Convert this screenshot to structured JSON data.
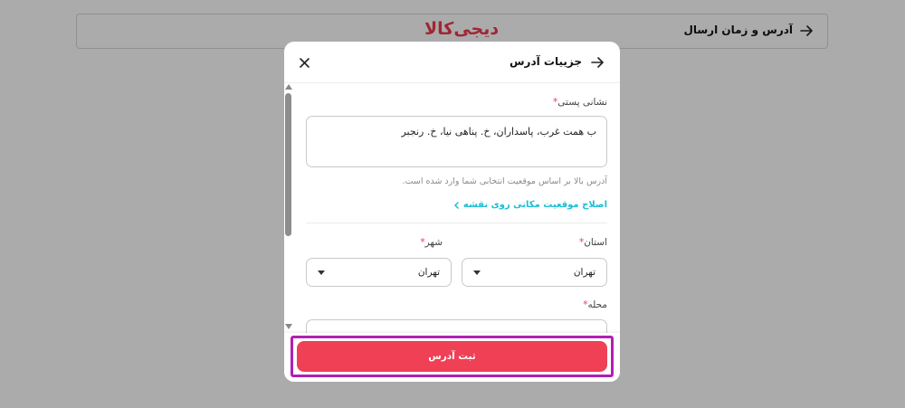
{
  "header": {
    "title": "آدرس و زمان ارسال",
    "logo": "دیجی‌کالا",
    "back_icon": "arrow-right-icon"
  },
  "modal": {
    "title": "جزییات آدرس",
    "back_icon": "arrow-right-icon",
    "close_icon": "close-icon",
    "postal_address": {
      "label": "نشانی پستی",
      "required_mark": "*",
      "value": "ب همت غرب، پاسداران، خ. پناهی نیا، خ. رنجبر",
      "hint": "آدرس بالا بر اساس موقعیت انتخابی شما وارد شده است."
    },
    "map_link": {
      "label": "اصلاح موقعیت مکانی روی نقشه",
      "icon": "chevron-left-icon"
    },
    "province": {
      "label": "استان",
      "required_mark": "*",
      "value": "تهران"
    },
    "city": {
      "label": "شهر",
      "required_mark": "*",
      "value": "تهران"
    },
    "neighborhood": {
      "label": "محله",
      "required_mark": "*"
    },
    "submit_label": "ثبت آدرس"
  },
  "colors": {
    "brand": "#ef394e",
    "submit": "#ef4056",
    "link": "#19bfd3",
    "highlight": "#b11fb5"
  }
}
